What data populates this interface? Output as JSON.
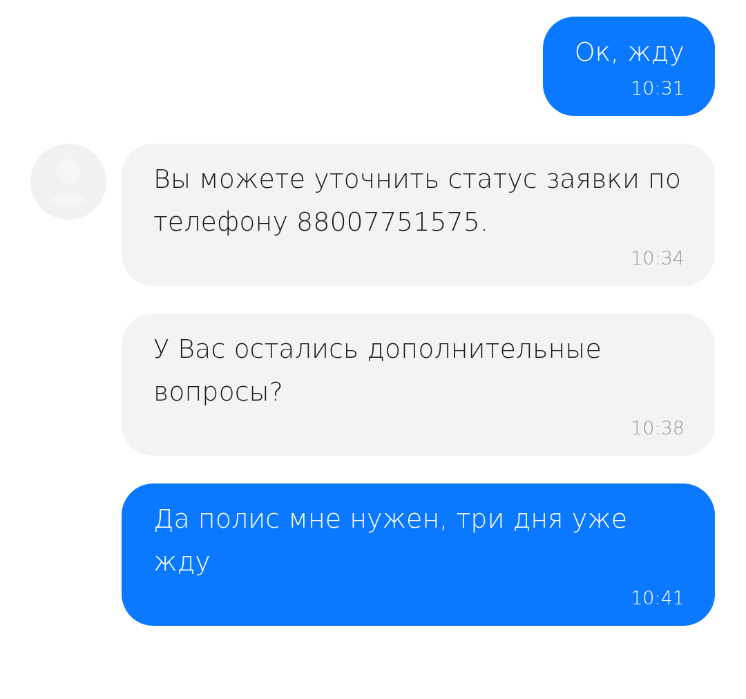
{
  "messages": [
    {
      "kind": "outgoing",
      "avatar": false,
      "text": "Ок, жду",
      "time": "10:31"
    },
    {
      "kind": "incoming",
      "avatar": true,
      "text": "Вы можете уточнить статус заявки по телефону 88007751575.",
      "time": "10:34"
    },
    {
      "kind": "incoming",
      "avatar": false,
      "text": "У Вас остались дополнительные вопросы?",
      "time": "10:38"
    },
    {
      "kind": "outgoing",
      "avatar": false,
      "wide": true,
      "text": "Да полис мне нужен, три дня уже жду",
      "time": "10:41"
    }
  ]
}
